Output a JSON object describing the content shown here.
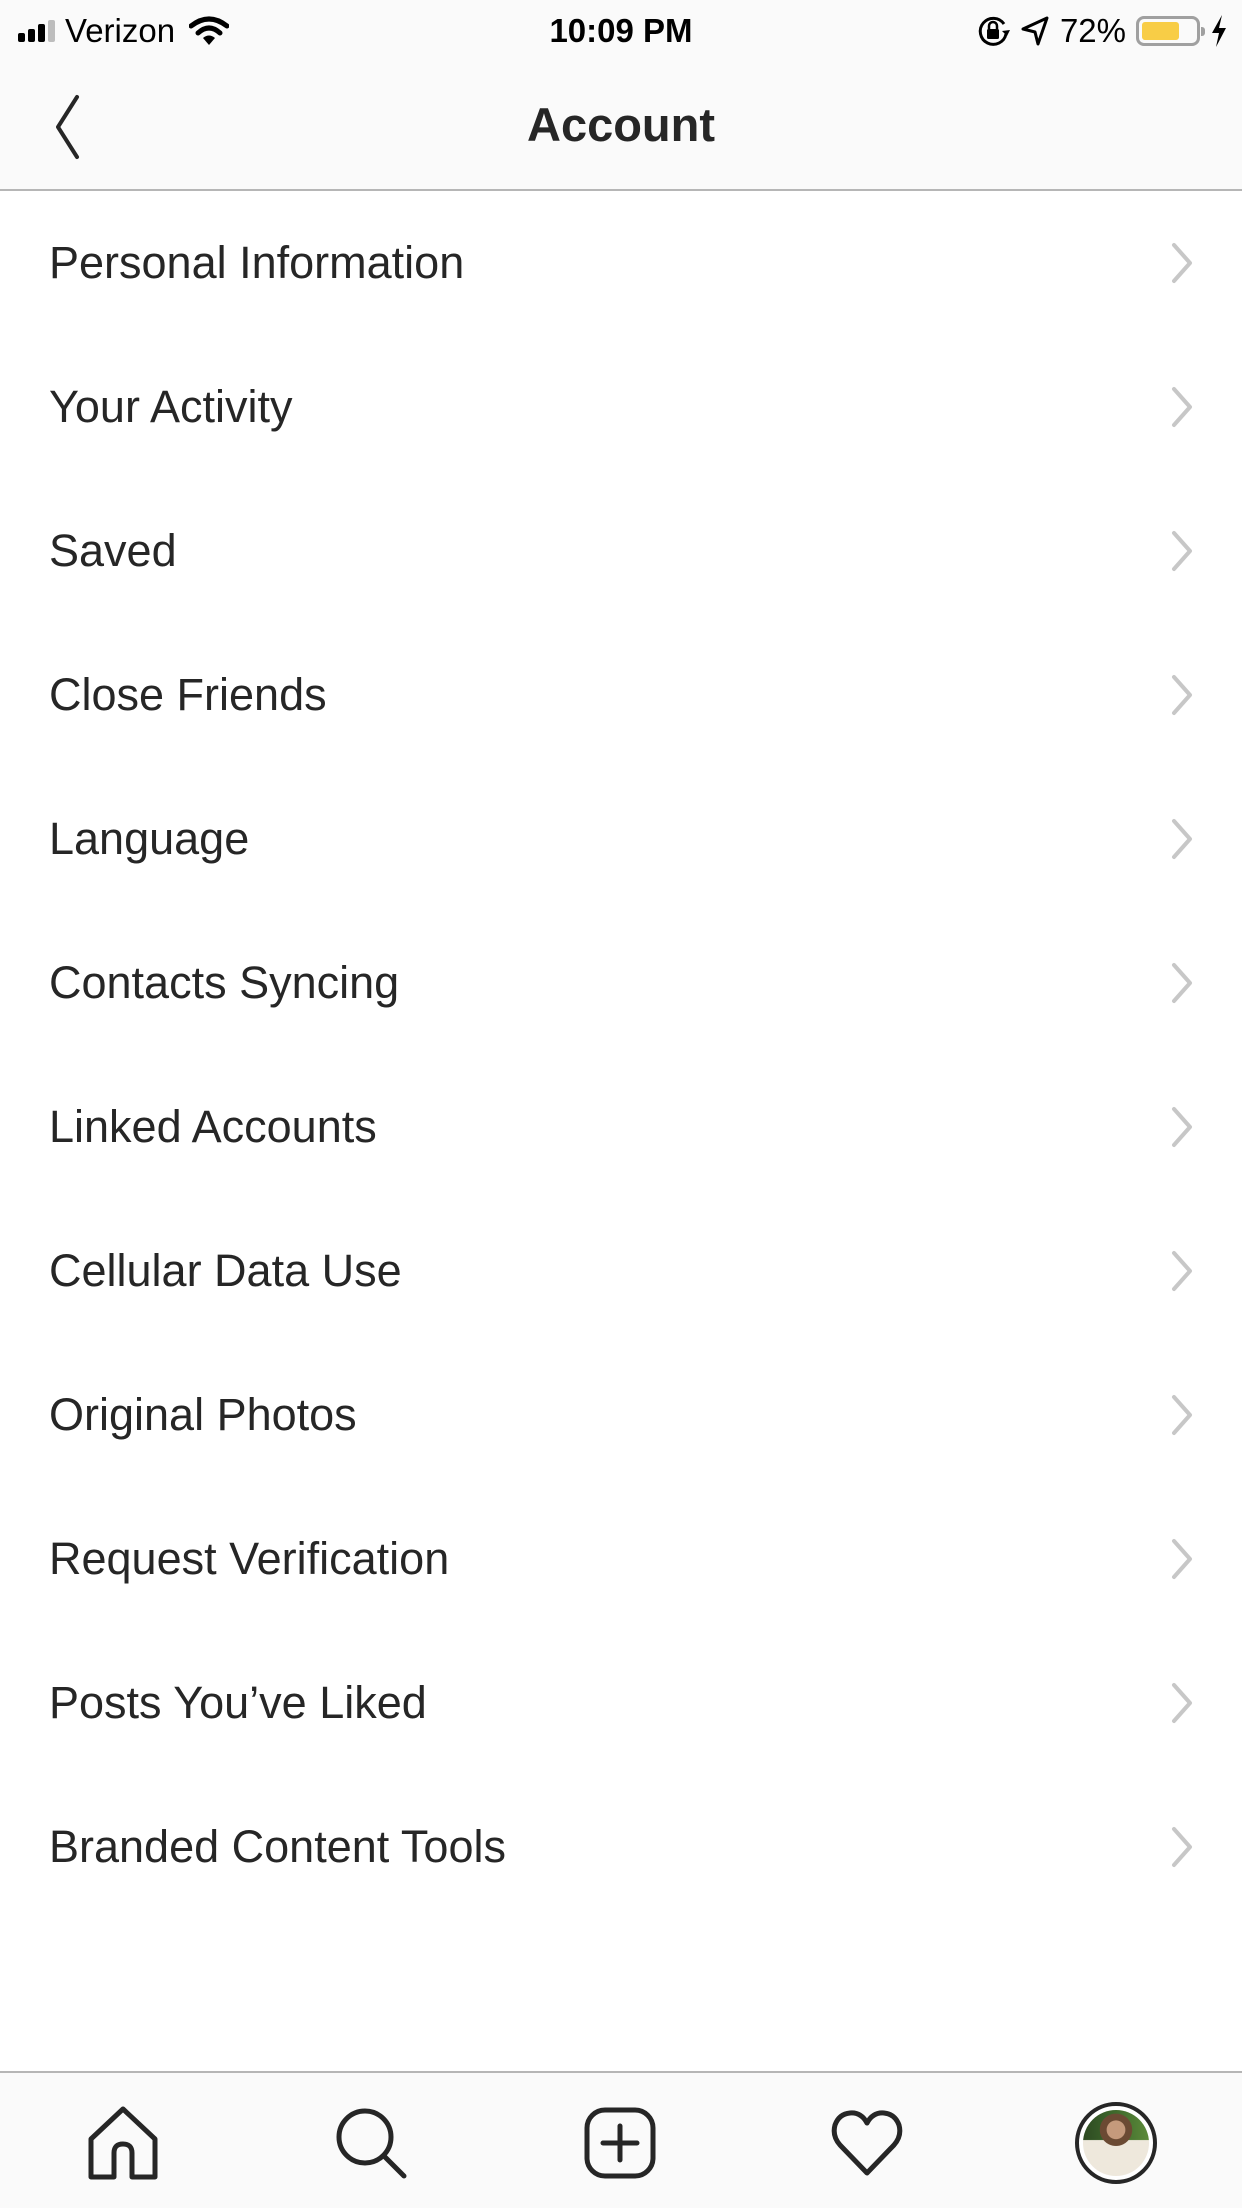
{
  "status_bar": {
    "carrier": "Verizon",
    "time": "10:09 PM",
    "battery_percent_label": "72%",
    "battery_level": 0.72,
    "signal_bars_active": 3,
    "signal_bars_total": 4,
    "icons": [
      "signal-icon",
      "wifi-icon",
      "rotation-lock-icon",
      "location-arrow-icon",
      "battery-icon",
      "charging-bolt-icon"
    ],
    "battery_color": "#f8cd46"
  },
  "header": {
    "title": "Account",
    "back_icon": "chevron-left-icon"
  },
  "menu": {
    "items": [
      {
        "label": "Personal Information"
      },
      {
        "label": "Your Activity"
      },
      {
        "label": "Saved"
      },
      {
        "label": "Close Friends"
      },
      {
        "label": "Language"
      },
      {
        "label": "Contacts Syncing"
      },
      {
        "label": "Linked Accounts"
      },
      {
        "label": "Cellular Data Use"
      },
      {
        "label": "Original Photos"
      },
      {
        "label": "Request Verification"
      },
      {
        "label": "Posts You’ve Liked"
      },
      {
        "label": "Branded Content Tools"
      }
    ],
    "chevron_icon": "chevron-right-icon",
    "chevron_color": "#c7c7c7"
  },
  "tab_bar": {
    "tabs": [
      {
        "name": "home",
        "icon": "home-icon"
      },
      {
        "name": "search",
        "icon": "search-icon"
      },
      {
        "name": "new-post",
        "icon": "plus-square-icon"
      },
      {
        "name": "activity",
        "icon": "heart-icon"
      },
      {
        "name": "profile",
        "icon": "avatar",
        "active": true
      }
    ]
  }
}
